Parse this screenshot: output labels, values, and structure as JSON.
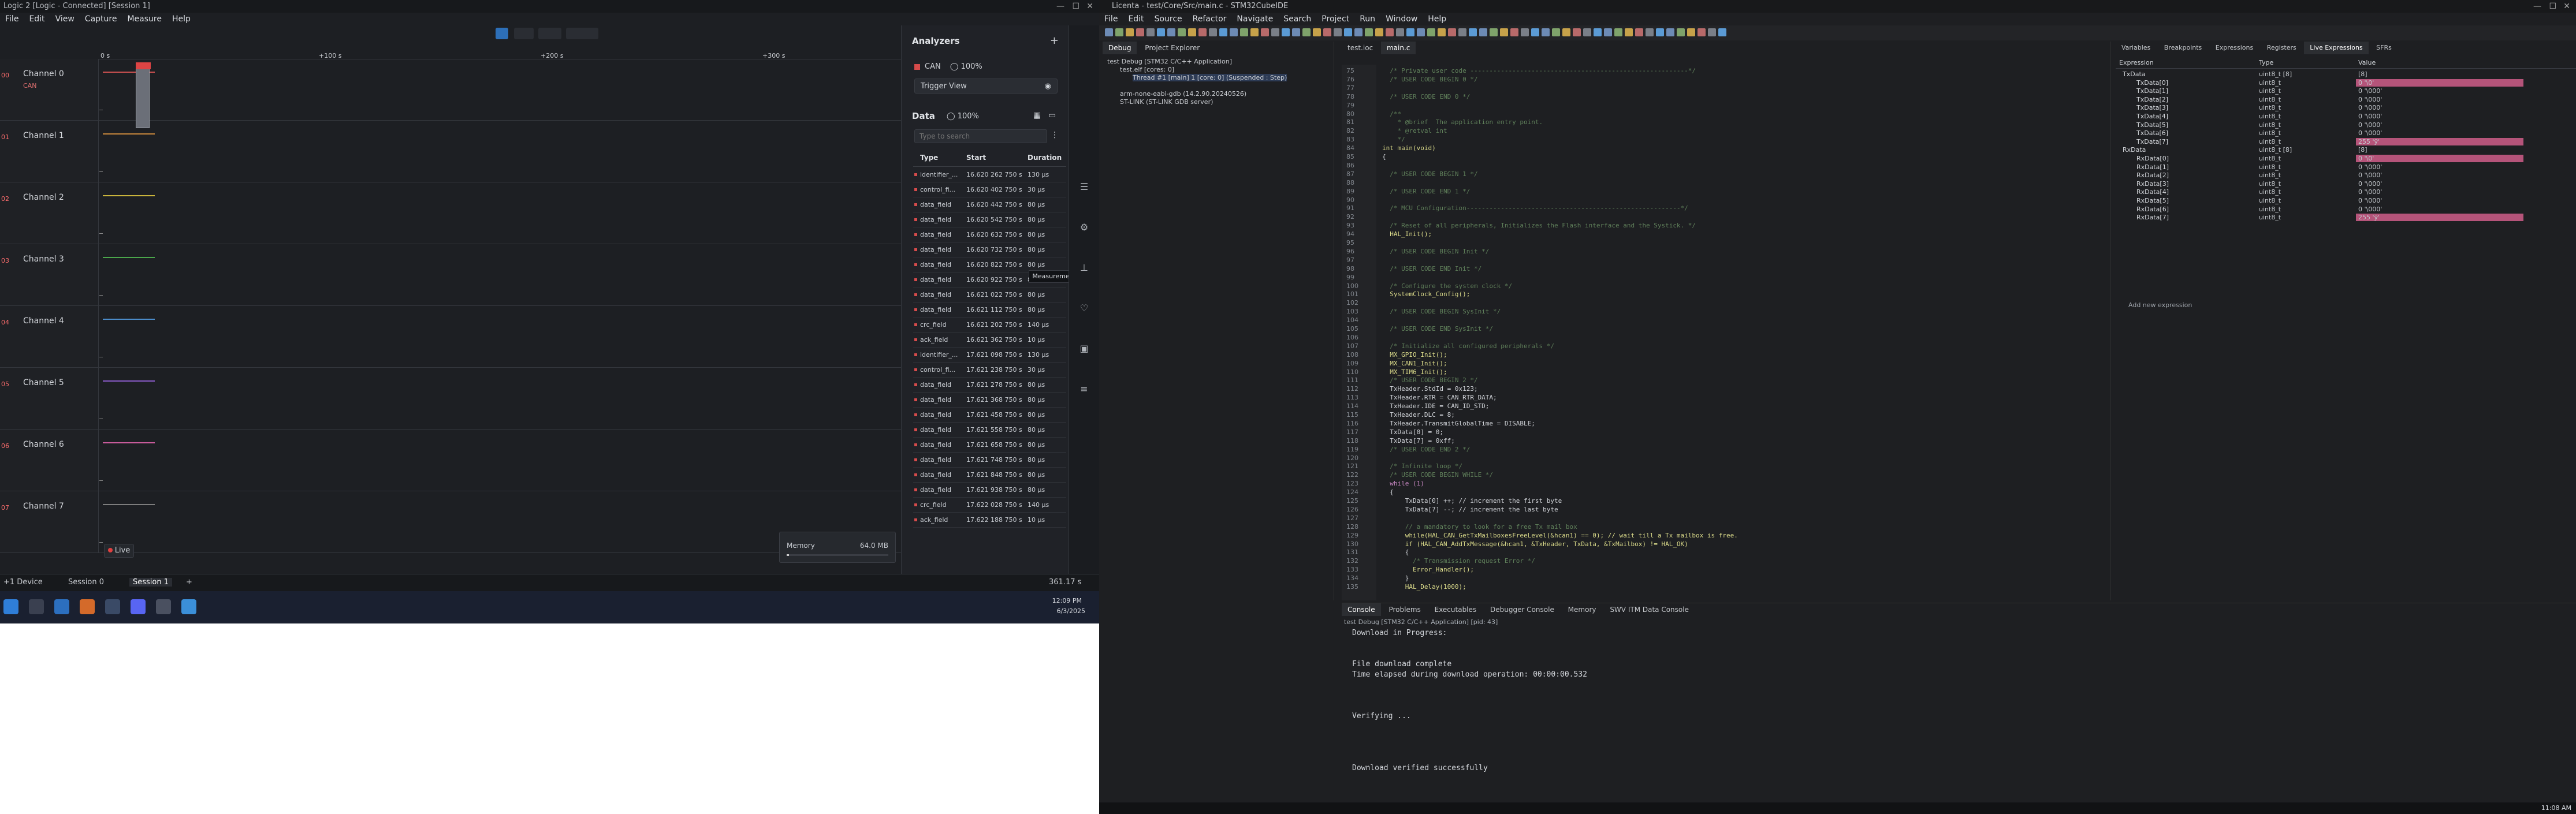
{
  "logic": {
    "title": "Logic 2 [Logic - Connected] [Session 1]",
    "menu": [
      "File",
      "Edit",
      "View",
      "Capture",
      "Measure",
      "Help"
    ],
    "timeline_ticks": [
      "0 s",
      "+100 s",
      "+200 s",
      "+300 s"
    ],
    "channels": [
      {
        "num": "00",
        "name": "Channel 0",
        "sub": "CAN"
      },
      {
        "num": "01",
        "name": "Channel 1",
        "sub": ""
      },
      {
        "num": "02",
        "name": "Channel 2",
        "sub": ""
      },
      {
        "num": "03",
        "name": "Channel 3",
        "sub": ""
      },
      {
        "num": "04",
        "name": "Channel 4",
        "sub": ""
      },
      {
        "num": "05",
        "name": "Channel 5",
        "sub": ""
      },
      {
        "num": "06",
        "name": "Channel 6",
        "sub": ""
      },
      {
        "num": "07",
        "name": "Channel 7",
        "sub": ""
      }
    ],
    "channel_colors": [
      "#c95050",
      "#c7873c",
      "#c9b43c",
      "#4ba64b",
      "#4b8bc9",
      "#8a5bc9",
      "#c95b9c",
      "#7d7d7d"
    ],
    "live_label": "Live",
    "memory_label": "Memory",
    "memory_value": "64.0 MB",
    "analyzers": {
      "title": "Analyzers",
      "add": "+",
      "can_label": "CAN",
      "can_pct": "100%",
      "trigger_view": "Trigger View",
      "data_title": "Data",
      "data_pct": "100%",
      "search_placeholder": "Type to search",
      "columns": [
        "Type",
        "Start",
        "Duration"
      ],
      "rows": [
        [
          "identifier_...",
          "16.620 262 750 s",
          "130 μs"
        ],
        [
          "control_fi...",
          "16.620 402 750 s",
          "30 μs"
        ],
        [
          "data_field",
          "16.620 442 750 s",
          "80 μs"
        ],
        [
          "data_field",
          "16.620 542 750 s",
          "80 μs"
        ],
        [
          "data_field",
          "16.620 632 750 s",
          "80 μs"
        ],
        [
          "data_field",
          "16.620 732 750 s",
          "80 μs"
        ],
        [
          "data_field",
          "16.620 822 750 s",
          "80 μs"
        ],
        [
          "data_field",
          "16.620 922 750 s",
          "80 μs"
        ],
        [
          "data_field",
          "16.621 022 750 s",
          "80 μs"
        ],
        [
          "data_field",
          "16.621 112 750 s",
          "80 μs"
        ],
        [
          "crc_field",
          "16.621 202 750 s",
          "140 μs"
        ],
        [
          "ack_field",
          "16.621 362 750 s",
          "10 μs"
        ],
        [
          "identifier_...",
          "17.621 098 750 s",
          "130 μs"
        ],
        [
          "control_fi...",
          "17.621 238 750 s",
          "30 μs"
        ],
        [
          "data_field",
          "17.621 278 750 s",
          "80 μs"
        ],
        [
          "data_field",
          "17.621 368 750 s",
          "80 μs"
        ],
        [
          "data_field",
          "17.621 458 750 s",
          "80 μs"
        ],
        [
          "data_field",
          "17.621 558 750 s",
          "80 μs"
        ],
        [
          "data_field",
          "17.621 658 750 s",
          "80 μs"
        ],
        [
          "data_field",
          "17.621 748 750 s",
          "80 μs"
        ],
        [
          "data_field",
          "17.621 848 750 s",
          "80 μs"
        ],
        [
          "data_field",
          "17.621 938 750 s",
          "80 μs"
        ],
        [
          "crc_field",
          "17.622 028 750 s",
          "140 μs"
        ],
        [
          "ack_field",
          "17.622 188 750 s",
          "10 μs"
        ]
      ],
      "tooltip": "Measurements"
    },
    "tabs": [
      "+1 Device",
      "Session 0",
      "Session 1",
      "+"
    ],
    "status_right": "361.17 s",
    "clock": {
      "time": "12:09 PM",
      "date": "6/3/2025"
    }
  },
  "ide": {
    "title": "Licenta - test/Core/Src/main.c - STM32CubeIDE",
    "menu": [
      "File",
      "Edit",
      "Source",
      "Refactor",
      "Navigate",
      "Search",
      "Project",
      "Run",
      "Window",
      "Help"
    ],
    "debug_tabs": [
      "Debug",
      "Project Explorer"
    ],
    "debug_tree": [
      "test Debug [STM32 C/C++ Application]",
      "test.elf [cores: 0]",
      "Thread #1 [main] 1 [core: 0] (Suspended : Step)",
      "arm-none-eabi-gdb (14.2.90.20240526)",
      "ST-LINK (ST-LINK GDB server)"
    ],
    "editor_tabs": [
      "test.ioc",
      "main.c"
    ],
    "code_lines": [
      {
        "n": "75",
        "t": "  /* Private user code ---------------------------------------------------------*/",
        "c": "c-com"
      },
      {
        "n": "76",
        "t": "  /* USER CODE BEGIN 0 */",
        "c": "c-com"
      },
      {
        "n": "77",
        "t": "",
        "c": "c-id"
      },
      {
        "n": "78",
        "t": "  /* USER CODE END 0 */",
        "c": "c-com"
      },
      {
        "n": "79",
        "t": "",
        "c": "c-id"
      },
      {
        "n": "80",
        "t": "  /**",
        "c": "c-com"
      },
      {
        "n": "81",
        "t": "    * @brief  The application entry point.",
        "c": "c-com"
      },
      {
        "n": "82",
        "t": "    * @retval int",
        "c": "c-com"
      },
      {
        "n": "83",
        "t": "    */",
        "c": "c-com"
      },
      {
        "n": "84",
        "t": "int main(void)",
        "c": "c-fn"
      },
      {
        "n": "85",
        "t": "{",
        "c": "c-id"
      },
      {
        "n": "86",
        "t": "",
        "c": "c-id"
      },
      {
        "n": "87",
        "t": "  /* USER CODE BEGIN 1 */",
        "c": "c-com"
      },
      {
        "n": "88",
        "t": "",
        "c": "c-id"
      },
      {
        "n": "89",
        "t": "  /* USER CODE END 1 */",
        "c": "c-com"
      },
      {
        "n": "90",
        "t": "",
        "c": "c-id"
      },
      {
        "n": "91",
        "t": "  /* MCU Configuration--------------------------------------------------------*/",
        "c": "c-com"
      },
      {
        "n": "92",
        "t": "",
        "c": "c-id"
      },
      {
        "n": "93",
        "t": "  /* Reset of all peripherals, Initializes the Flash interface and the Systick. */",
        "c": "c-com"
      },
      {
        "n": "94",
        "t": "  HAL_Init();",
        "c": "c-fn"
      },
      {
        "n": "95",
        "t": "",
        "c": "c-id"
      },
      {
        "n": "96",
        "t": "  /* USER CODE BEGIN Init */",
        "c": "c-com"
      },
      {
        "n": "97",
        "t": "",
        "c": "c-id"
      },
      {
        "n": "98",
        "t": "  /* USER CODE END Init */",
        "c": "c-com"
      },
      {
        "n": "99",
        "t": "",
        "c": "c-id"
      },
      {
        "n": "100",
        "t": "  /* Configure the system clock */",
        "c": "c-com"
      },
      {
        "n": "101",
        "t": "  SystemClock_Config();",
        "c": "c-fn"
      },
      {
        "n": "102",
        "t": "",
        "c": "c-id"
      },
      {
        "n": "103",
        "t": "  /* USER CODE BEGIN SysInit */",
        "c": "c-com"
      },
      {
        "n": "104",
        "t": "",
        "c": "c-id"
      },
      {
        "n": "105",
        "t": "  /* USER CODE END SysInit */",
        "c": "c-com"
      },
      {
        "n": "106",
        "t": "",
        "c": "c-id"
      },
      {
        "n": "107",
        "t": "  /* Initialize all configured peripherals */",
        "c": "c-com"
      },
      {
        "n": "108",
        "t": "  MX_GPIO_Init();",
        "c": "c-fn"
      },
      {
        "n": "109",
        "t": "  MX_CAN1_Init();",
        "c": "c-fn"
      },
      {
        "n": "110",
        "t": "  MX_TIM6_Init();",
        "c": "c-fn"
      },
      {
        "n": "111",
        "t": "  /* USER CODE BEGIN 2 */",
        "c": "c-com"
      },
      {
        "n": "112",
        "t": "  TxHeader.StdId = 0x123;",
        "c": "c-id"
      },
      {
        "n": "113",
        "t": "  TxHeader.RTR = CAN_RTR_DATA;",
        "c": "c-id"
      },
      {
        "n": "114",
        "t": "  TxHeader.IDE = CAN_ID_STD;",
        "c": "c-id"
      },
      {
        "n": "115",
        "t": "  TxHeader.DLC = 8;",
        "c": "c-id"
      },
      {
        "n": "116",
        "t": "  TxHeader.TransmitGlobalTime = DISABLE;",
        "c": "c-id"
      },
      {
        "n": "117",
        "t": "  TxData[0] = 0;",
        "c": "c-id"
      },
      {
        "n": "118",
        "t": "  TxData[7] = 0xff;",
        "c": "c-id"
      },
      {
        "n": "119",
        "t": "  /* USER CODE END 2 */",
        "c": "c-com"
      },
      {
        "n": "120",
        "t": "",
        "c": "c-id"
      },
      {
        "n": "121",
        "t": "  /* Infinite loop */",
        "c": "c-com"
      },
      {
        "n": "122",
        "t": "  /* USER CODE BEGIN WHILE */",
        "c": "c-com"
      },
      {
        "n": "123",
        "t": "  while (1)",
        "c": "c-kw"
      },
      {
        "n": "124",
        "t": "  {",
        "c": "c-id"
      },
      {
        "n": "125",
        "t": "      TxData[0] ++; // increment the first byte",
        "c": "c-id"
      },
      {
        "n": "126",
        "t": "      TxData[7] --; // increment the last byte",
        "c": "c-id"
      },
      {
        "n": "127",
        "t": "",
        "c": "c-id"
      },
      {
        "n": "128",
        "t": "      // a mandatory to look for a free Tx mail box",
        "c": "c-com"
      },
      {
        "n": "129",
        "t": "      while(HAL_CAN_GetTxMailboxesFreeLevel(&hcan1) == 0); // wait till a Tx mailbox is free.",
        "c": "c-fn"
      },
      {
        "n": "130",
        "t": "      if (HAL_CAN_AddTxMessage(&hcan1, &TxHeader, TxData, &TxMailbox) != HAL_OK)",
        "c": "c-fn"
      },
      {
        "n": "131",
        "t": "      {",
        "c": "c-id"
      },
      {
        "n": "132",
        "t": "        /* Transmission request Error */",
        "c": "c-com"
      },
      {
        "n": "133",
        "t": "        Error_Handler();",
        "c": "c-fn"
      },
      {
        "n": "134",
        "t": "      }",
        "c": "c-id"
      },
      {
        "n": "135",
        "t": "      HAL_Delay(1000);",
        "c": "c-fn"
      }
    ],
    "expr_tabs": [
      "Variables",
      "Breakpoints",
      "Expressions",
      "Registers",
      "Live Expressions",
      "SFRs"
    ],
    "expr_columns": [
      "Expression",
      "Type",
      "Value"
    ],
    "expr_rows": [
      {
        "name": "TxData",
        "type": "uint8_t [8]",
        "value": "[8]",
        "hl": false,
        "indent": 0
      },
      {
        "name": "TxData[0]",
        "type": "uint8_t",
        "value": "0 '\\0'",
        "hl": true,
        "indent": 1
      },
      {
        "name": "TxData[1]",
        "type": "uint8_t",
        "value": "0 '\\000'",
        "hl": false,
        "indent": 1
      },
      {
        "name": "TxData[2]",
        "type": "uint8_t",
        "value": "0 '\\000'",
        "hl": false,
        "indent": 1
      },
      {
        "name": "TxData[3]",
        "type": "uint8_t",
        "value": "0 '\\000'",
        "hl": false,
        "indent": 1
      },
      {
        "name": "TxData[4]",
        "type": "uint8_t",
        "value": "0 '\\000'",
        "hl": false,
        "indent": 1
      },
      {
        "name": "TxData[5]",
        "type": "uint8_t",
        "value": "0 '\\000'",
        "hl": false,
        "indent": 1
      },
      {
        "name": "TxData[6]",
        "type": "uint8_t",
        "value": "0 '\\000'",
        "hl": false,
        "indent": 1
      },
      {
        "name": "TxData[7]",
        "type": "uint8_t",
        "value": "255 'ÿ'",
        "hl": true,
        "indent": 1
      },
      {
        "name": "RxData",
        "type": "uint8_t [8]",
        "value": "[8]",
        "hl": false,
        "indent": 0
      },
      {
        "name": "RxData[0]",
        "type": "uint8_t",
        "value": "0 '\\0'",
        "hl": true,
        "indent": 1
      },
      {
        "name": "RxData[1]",
        "type": "uint8_t",
        "value": "0 '\\000'",
        "hl": false,
        "indent": 1
      },
      {
        "name": "RxData[2]",
        "type": "uint8_t",
        "value": "0 '\\000'",
        "hl": false,
        "indent": 1
      },
      {
        "name": "RxData[3]",
        "type": "uint8_t",
        "value": "0 '\\000'",
        "hl": false,
        "indent": 1
      },
      {
        "name": "RxData[4]",
        "type": "uint8_t",
        "value": "0 '\\000'",
        "hl": false,
        "indent": 1
      },
      {
        "name": "RxData[5]",
        "type": "uint8_t",
        "value": "0 '\\000'",
        "hl": false,
        "indent": 1
      },
      {
        "name": "RxData[6]",
        "type": "uint8_t",
        "value": "0 '\\000'",
        "hl": false,
        "indent": 1
      },
      {
        "name": "RxData[7]",
        "type": "uint8_t",
        "value": "255 'ÿ'",
        "hl": true,
        "indent": 1
      }
    ],
    "add_expression": "Add new expression",
    "console_tabs": [
      "Console",
      "Problems",
      "Executables",
      "Debugger Console",
      "Memory",
      "SWV ITM Data Console"
    ],
    "console_header": "test Debug [STM32 C/C++ Application] [pid: 43]",
    "console_lines": [
      "Download in Progress:",
      "",
      "",
      "File download complete",
      "Time elapsed during download operation: 00:00:00.532",
      "",
      "",
      "",
      "Verifying ...",
      "",
      "",
      "",
      "",
      "Download verified successfully"
    ],
    "clock": "11:08 AM"
  }
}
